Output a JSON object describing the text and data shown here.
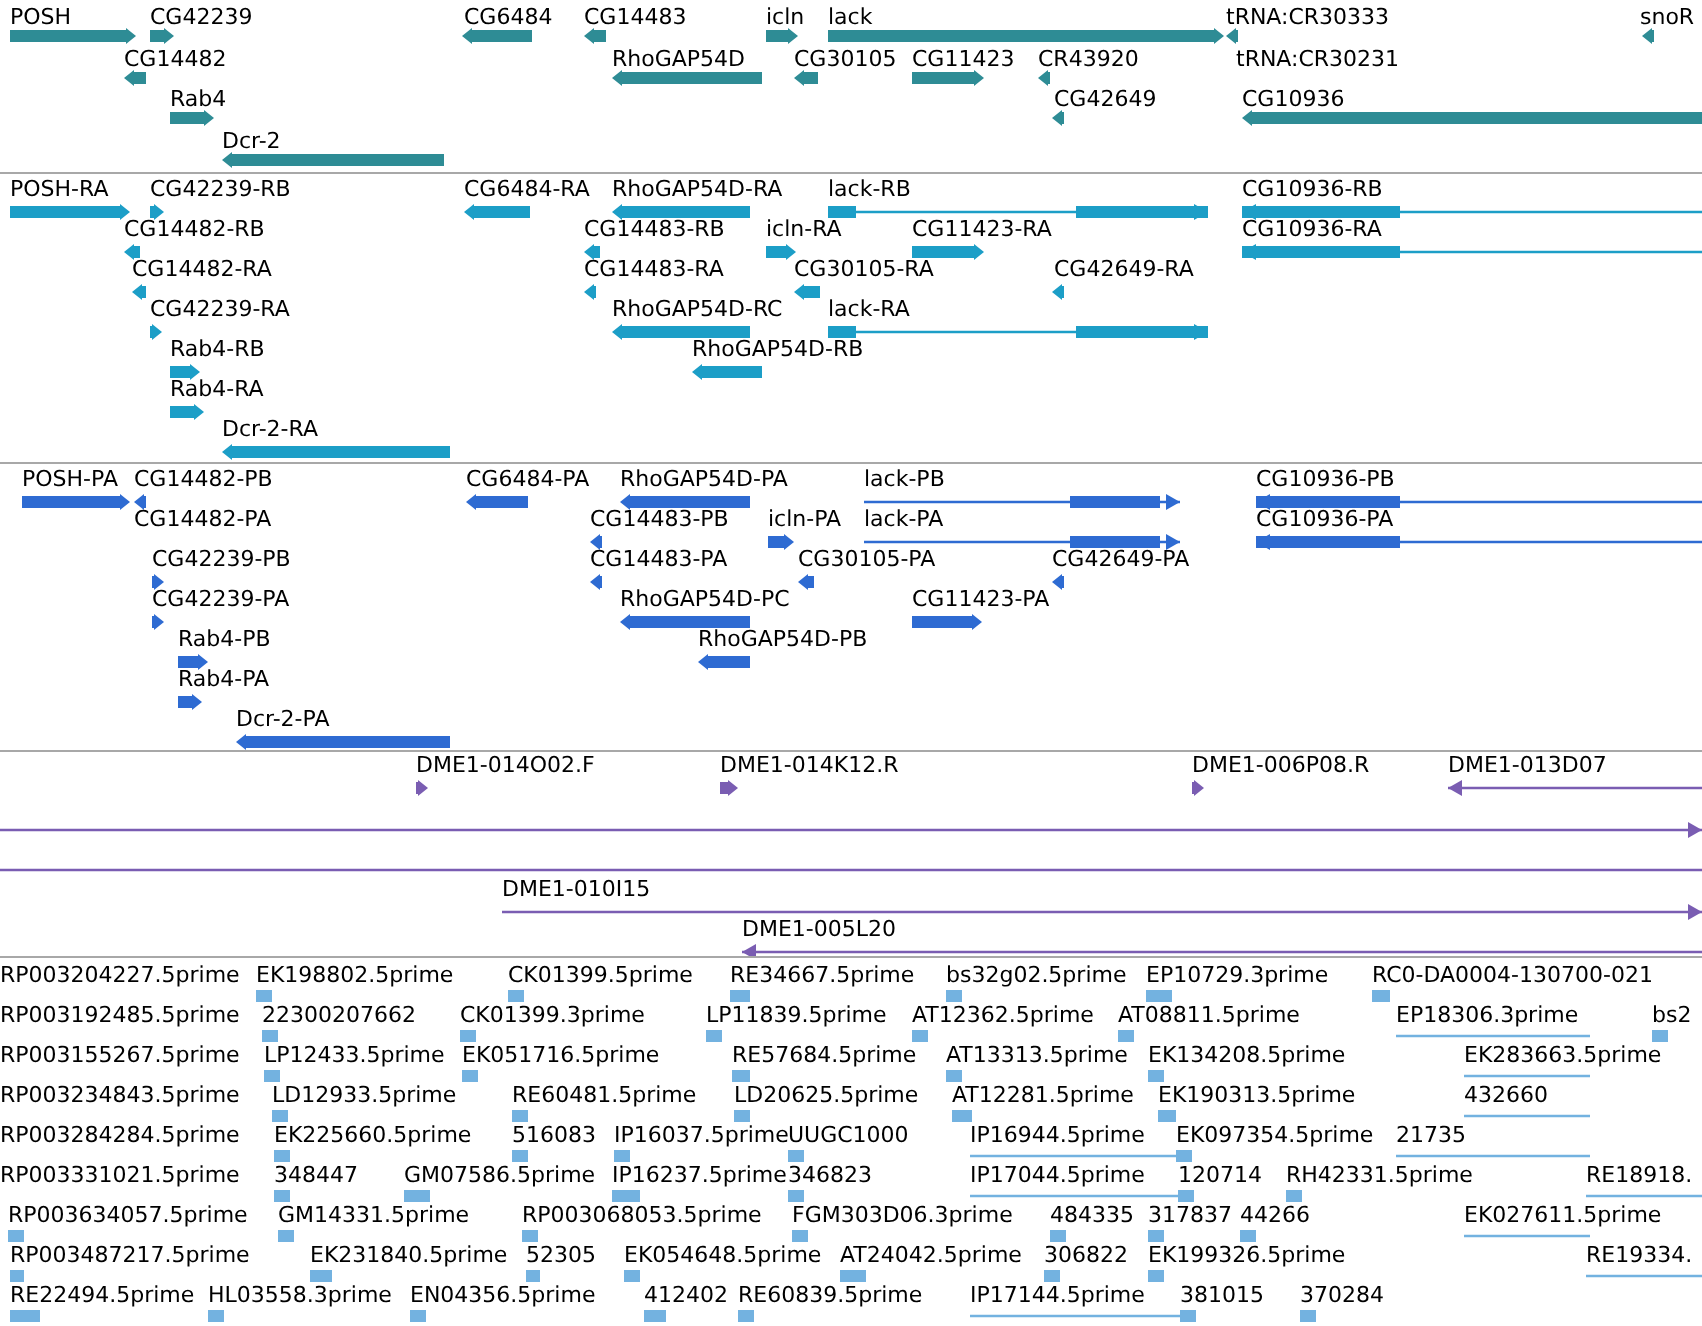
{
  "tracks": [
    {
      "kind": "gene",
      "features": [
        {
          "label": "POSH",
          "reverse": false
        },
        {
          "label": "CG42239",
          "reverse": false
        },
        {
          "label": "CG6484",
          "reverse": true
        },
        {
          "label": "CG14483",
          "reverse": true
        },
        {
          "label": "icln",
          "reverse": false
        },
        {
          "label": "lack",
          "reverse": false
        },
        {
          "label": "tRNA:CR30333",
          "reverse": true
        },
        {
          "label": "snoR",
          "reverse": true
        },
        {
          "label": "CG14482",
          "reverse": true
        },
        {
          "label": "RhoGAP54D",
          "reverse": true
        },
        {
          "label": "CG30105",
          "reverse": true
        },
        {
          "label": "CG11423",
          "reverse": false
        },
        {
          "label": "CR43920",
          "reverse": true
        },
        {
          "label": "tRNA:CR30231"
        },
        {
          "label": "Rab4",
          "reverse": false
        },
        {
          "label": "CG42649",
          "reverse": true
        },
        {
          "label": "CG10936",
          "reverse": true
        },
        {
          "label": "Dcr-2",
          "reverse": true
        }
      ]
    },
    {
      "kind": "mrna",
      "features": [
        {
          "label": "POSH-RA",
          "reverse": false
        },
        {
          "label": "CG42239-RB",
          "reverse": false
        },
        {
          "label": "CG6484-RA",
          "reverse": true
        },
        {
          "label": "RhoGAP54D-RA",
          "reverse": true
        },
        {
          "label": "lack-RB",
          "reverse": false
        },
        {
          "label": "CG10936-RB",
          "reverse": true
        },
        {
          "label": "CG14482-RB",
          "reverse": true
        },
        {
          "label": "CG14483-RB",
          "reverse": true
        },
        {
          "label": "icln-RA",
          "reverse": false
        },
        {
          "label": "CG11423-RA",
          "reverse": false
        },
        {
          "label": "CG10936-RA",
          "reverse": true
        },
        {
          "label": "CG14482-RA",
          "reverse": true
        },
        {
          "label": "CG14483-RA",
          "reverse": true
        },
        {
          "label": "CG30105-RA",
          "reverse": true
        },
        {
          "label": "CG42649-RA",
          "reverse": true
        },
        {
          "label": "CG42239-RA",
          "reverse": false
        },
        {
          "label": "RhoGAP54D-RC",
          "reverse": true
        },
        {
          "label": "lack-RA",
          "reverse": false
        },
        {
          "label": "Rab4-RB",
          "reverse": false
        },
        {
          "label": "RhoGAP54D-RB",
          "reverse": true
        },
        {
          "label": "Rab4-RA",
          "reverse": false
        },
        {
          "label": "Dcr-2-RA",
          "reverse": true
        }
      ]
    },
    {
      "kind": "protein",
      "features": [
        {
          "label": "POSH-PA",
          "reverse": false
        },
        {
          "label": "CG14482-PB",
          "reverse": true
        },
        {
          "label": "CG6484-PA",
          "reverse": true
        },
        {
          "label": "RhoGAP54D-PA",
          "reverse": true
        },
        {
          "label": "lack-PB",
          "reverse": false
        },
        {
          "label": "CG10936-PB",
          "reverse": true
        },
        {
          "label": "CG14482-PA"
        },
        {
          "label": "CG14483-PB",
          "reverse": true
        },
        {
          "label": "icln-PA",
          "reverse": false
        },
        {
          "label": "lack-PA",
          "reverse": false
        },
        {
          "label": "CG10936-PA",
          "reverse": true
        },
        {
          "label": "CG42239-PB",
          "reverse": false
        },
        {
          "label": "CG14483-PA",
          "reverse": true
        },
        {
          "label": "CG30105-PA",
          "reverse": true
        },
        {
          "label": "CG42649-PA",
          "reverse": true
        },
        {
          "label": "CG42239-PA",
          "reverse": false
        },
        {
          "label": "RhoGAP54D-PC",
          "reverse": true
        },
        {
          "label": "CG11423-PA",
          "reverse": false
        },
        {
          "label": "Rab4-PB",
          "reverse": false
        },
        {
          "label": "RhoGAP54D-PB",
          "reverse": true
        },
        {
          "label": "Rab4-PA",
          "reverse": false
        },
        {
          "label": "Dcr-2-PA",
          "reverse": true
        }
      ]
    },
    {
      "kind": "clone",
      "features": [
        {
          "label": "DME1-014O02.F",
          "kind": "marker",
          "reverse": false
        },
        {
          "label": "DME1-014K12.R",
          "kind": "marker",
          "reverse": false
        },
        {
          "label": "DME1-006P08.R",
          "kind": "marker",
          "reverse": false
        },
        {
          "label": "DME1-013D07",
          "kind": "line",
          "reverse": true
        },
        {
          "kind": "line",
          "reverse": false
        },
        {
          "kind": "line"
        },
        {
          "label": "DME1-010I15",
          "kind": "line",
          "reverse": false
        },
        {
          "label": "DME1-005L20",
          "kind": "line",
          "reverse": true
        }
      ]
    },
    {
      "kind": "est",
      "features": [
        {
          "label": "RP003204227.5prime"
        },
        {
          "label": "EK198802.5prime"
        },
        {
          "label": "CK01399.5prime"
        },
        {
          "label": "RE34667.5prime"
        },
        {
          "label": "bs32g02.5prime"
        },
        {
          "label": "EP10729.3prime"
        },
        {
          "label": "RC0-DA0004-130700-021"
        },
        {
          "label": "RP003192485.5prime"
        },
        {
          "label": "22300207662"
        },
        {
          "label": "CK01399.3prime"
        },
        {
          "label": "LP11839.5prime"
        },
        {
          "label": "AT12362.5prime"
        },
        {
          "label": "AT08811.5prime"
        },
        {
          "label": "EP18306.3prime"
        },
        {
          "label": "bs2"
        },
        {
          "label": "RP003155267.5prime"
        },
        {
          "label": "LP12433.5prime"
        },
        {
          "label": "EK051716.5prime"
        },
        {
          "label": "RE57684.5prime"
        },
        {
          "label": "AT13313.5prime"
        },
        {
          "label": "EK134208.5prime"
        },
        {
          "label": "EK283663.5prime"
        },
        {
          "label": "RP003234843.5prime"
        },
        {
          "label": "LD12933.5prime"
        },
        {
          "label": "RE60481.5prime"
        },
        {
          "label": "LD20625.5prime"
        },
        {
          "label": "AT12281.5prime"
        },
        {
          "label": "EK190313.5prime"
        },
        {
          "label": "432660"
        },
        {
          "label": "RP003284284.5prime"
        },
        {
          "label": "EK225660.5prime"
        },
        {
          "label": "516083"
        },
        {
          "label": "IP16037.5prime"
        },
        {
          "label": "UUGC1000"
        },
        {
          "label": "IP16944.5prime"
        },
        {
          "label": "EK097354.5prime"
        },
        {
          "label": "21735"
        },
        {
          "label": "RP003331021.5prime"
        },
        {
          "label": "348447"
        },
        {
          "label": "GM07586.5prime"
        },
        {
          "label": "IP16237.5prime"
        },
        {
          "label": "346823"
        },
        {
          "label": "IP17044.5prime"
        },
        {
          "label": "120714"
        },
        {
          "label": "RH42331.5prime"
        },
        {
          "label": "RE18918."
        },
        {
          "label": "RP003634057.5prime"
        },
        {
          "label": "GM14331.5prime"
        },
        {
          "label": "RP003068053.5prime"
        },
        {
          "label": "FGM303D06.3prime"
        },
        {
          "label": "484335"
        },
        {
          "label": "317837"
        },
        {
          "label": "44266"
        },
        {
          "label": "EK027611.5prime"
        },
        {
          "label": "RP003487217.5prime"
        },
        {
          "label": "EK231840.5prime"
        },
        {
          "label": "52305"
        },
        {
          "label": "EK054648.5prime"
        },
        {
          "label": "AT24042.5prime"
        },
        {
          "label": "306822"
        },
        {
          "label": "EK199326.5prime"
        },
        {
          "label": "RE19334."
        },
        {
          "label": "RE22494.5prime"
        },
        {
          "label": "HL03558.3prime"
        },
        {
          "label": "EN04356.5prime"
        },
        {
          "label": "412402"
        },
        {
          "label": "RE60839.5prime"
        },
        {
          "label": "IP17144.5prime"
        },
        {
          "label": "381015"
        },
        {
          "label": "370284"
        }
      ]
    }
  ]
}
